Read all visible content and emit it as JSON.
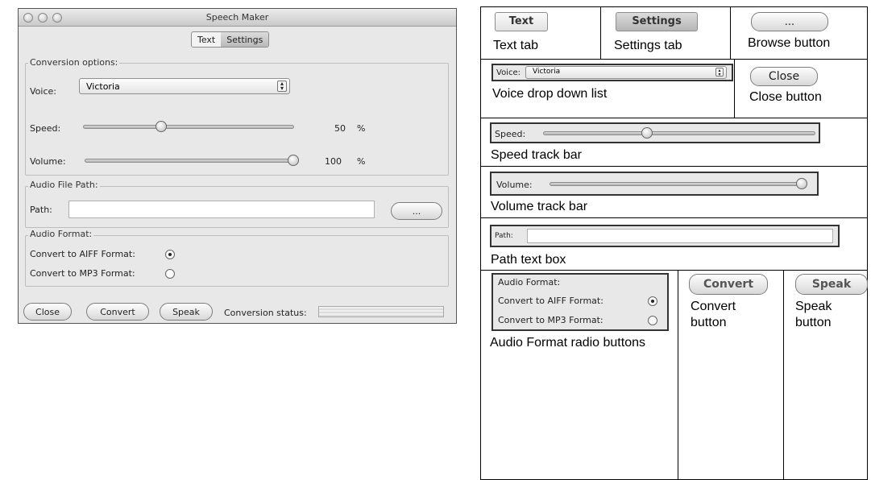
{
  "window": {
    "title": "Speech Maker",
    "tabs": [
      {
        "label": "Text",
        "selected": false
      },
      {
        "label": "Settings",
        "selected": true
      }
    ]
  },
  "conversion": {
    "group_label": "Conversion options:",
    "voice_label": "Voice:",
    "voice_value": "Victoria",
    "speed_label": "Speed:",
    "speed_value": "50",
    "speed_unit": "%",
    "volume_label": "Volume:",
    "volume_value": "100",
    "volume_unit": "%"
  },
  "audio_path": {
    "group_label": "Audio File Path:",
    "path_label": "Path:",
    "path_value": "",
    "browse_label": "..."
  },
  "audio_format": {
    "group_label": "Audio Format:",
    "aiff_label": "Convert to AIFF Format:",
    "mp3_label": "Convert to MP3 Format:",
    "selected": "aiff"
  },
  "footer": {
    "close_label": "Close",
    "convert_label": "Convert",
    "speak_label": "Speak",
    "status_label": "Conversion status:"
  },
  "legend": {
    "text_tab": "Text tab",
    "settings_tab": "Settings tab",
    "browse_button": "Browse button",
    "voice_list": "Voice drop down list",
    "close_button": "Close button",
    "speed_bar": "Speed track bar",
    "volume_bar": "Volume track bar",
    "path_box": "Path text box",
    "audio_radio": "Audio Format radio buttons",
    "convert_button": "Convert button",
    "speak_button": "Speak button"
  },
  "legend_samples": {
    "text_tab": "Text",
    "settings_tab": "Settings",
    "browse": "...",
    "voice_label": "Voice:",
    "voice_value": "Victoria",
    "close": "Close",
    "speed_label": "Speed:",
    "volume_label": "Volume:",
    "path_label": "Path:",
    "audio_group": "Audio Format:",
    "aiff_label": "Convert to AIFF Format:",
    "mp3_label": "Convert to MP3 Format:",
    "convert": "Convert",
    "speak": "Speak"
  }
}
